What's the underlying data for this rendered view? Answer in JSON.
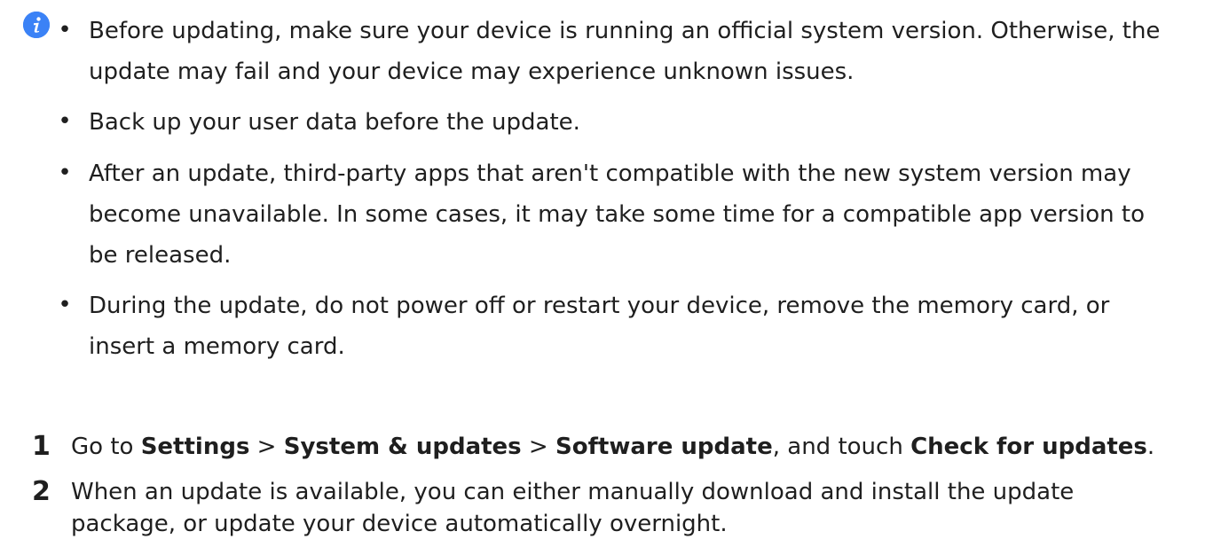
{
  "notes": [
    {
      "lines": [
        "Before updating, make sure your device is running an official system version. Otherwise, the",
        "update may fail and your device may experience unknown issues."
      ]
    },
    {
      "lines": [
        "Back up your user data before the update."
      ]
    },
    {
      "lines": [
        "After an update, third-party apps that aren't compatible with the new system version may",
        "become unavailable. In some cases, it may take some time for a compatible app version to",
        "be released."
      ]
    },
    {
      "lines": [
        "During the update, do not power off or restart your device, remove the memory card, or",
        "insert a memory card."
      ]
    }
  ],
  "bullet_glyph": "•",
  "steps": [
    {
      "number": "1",
      "parts": {
        "t1": "Go to ",
        "b1": "Settings",
        "t2": " > ",
        "b2": "System & updates",
        "t3": " > ",
        "b3": "Software update",
        "t4": ", and touch ",
        "b4": "Check for updates",
        "t5": "."
      }
    },
    {
      "number": "2",
      "lines": [
        "When an update is available, you can either manually download and install the update",
        "package, or update your device automatically overnight."
      ]
    }
  ],
  "colors": {
    "info_icon": "#3b82f6",
    "text": "#1f1f1f"
  },
  "icons": {
    "info": "info-icon"
  }
}
